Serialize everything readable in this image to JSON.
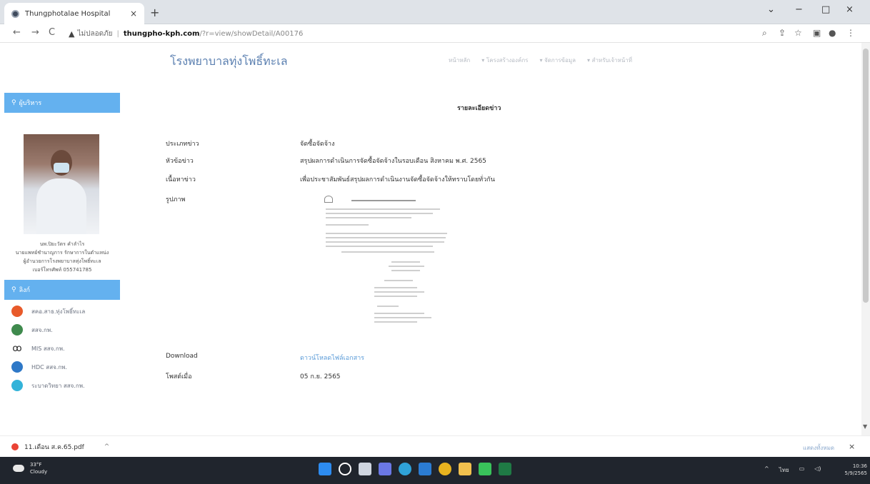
{
  "browser": {
    "tab_title": "Thungphotalae Hospital",
    "tab_close": "×",
    "new_tab": "+",
    "window_controls": {
      "chevron": "⌄",
      "minimize": "−",
      "maximize": "□",
      "close": "×"
    },
    "nav": {
      "back": "←",
      "forward": "→",
      "reload": "C"
    },
    "address": {
      "security_icon": "▲",
      "insecure_text": "ไม่ปลอดภัย",
      "separator": "|",
      "domain": "thungpho-kph.com",
      "path": "/?r=view/showDetail/A00176"
    },
    "toolbar_icons": [
      "search-icon",
      "share-icon",
      "bookmark-star-icon",
      "side-panel-icon",
      "profile-icon",
      "menu-icon"
    ]
  },
  "site": {
    "brand": "โรงพยาบาลทุ่งโพธิ์ทะเล",
    "nav_items": [
      "หน้าหลัก",
      "▾ โครงสร้างองค์กร",
      "▾ จัดการข้อมูล",
      "▾ สำหรับเจ้าหน้าที่"
    ]
  },
  "sidebar": {
    "director_header": "ผู้บริหาร",
    "person_lines": [
      "นพ.ปิยะวัตร คำลำไร",
      "นายแพทย์ชำนาญการ รักษาการในตำแหน่ง",
      "ผู้อำนวยการโรงพยาบาลทุ่งโพธิ์ทะเล",
      "เบอร์โทรศัพท์ 055741785"
    ],
    "links_header": "ลิงก์",
    "links": [
      {
        "label": "สคอ.สาธ.ทุ่งโพธิ์ทะเล",
        "icon": "emblem-icon",
        "color": "#e85a2a"
      },
      {
        "label": "สสจ.กพ.",
        "icon": "globe-green-icon",
        "color": "#3f8a4d"
      },
      {
        "label": "MIS สสจ.กพ.",
        "icon": "network-icon",
        "color": "#222222"
      },
      {
        "label": "HDC สสจ.กพ.",
        "icon": "globe-blue-icon",
        "color": "#2e78c7"
      },
      {
        "label": "ระบาดวิทยา สสจ.กพ.",
        "icon": "globe-cyan-icon",
        "color": "#33b3d9"
      }
    ]
  },
  "content": {
    "title": "รายละเอียดข่าว",
    "fields": [
      {
        "key": "ประเภทข่าว",
        "value": "จัดซื้อจัดจ้าง"
      },
      {
        "key": "หัวข้อข่าว",
        "value": "สรุปผลการดำเนินการจัดซื้อจัดจ้างในรอบเดือน สิงหาคม พ.ศ. 2565"
      },
      {
        "key": "เนื้อหาข่าว",
        "value": "เพื่อประชาสัมพันธ์สรุปผลการดำเนินงานจัดซื้อจัดจ้างให้ทราบโดยทั่วกัน"
      },
      {
        "key": "รูปภาพ",
        "value": ""
      }
    ],
    "download_key": "Download",
    "download_link": "ดาวน์โหลดไฟล์เอกสาร",
    "posted_key": "โพสต์เมื่อ",
    "posted_value": "05 ก.ย. 2565"
  },
  "download_bar": {
    "filename": "11.เดือน ส.ค.65.pdf",
    "chevron": "^",
    "show_all": "แสดงทั้งหมด",
    "close": "×"
  },
  "taskbar": {
    "weather_temp": "33°F",
    "weather_desc": "Cloudy",
    "apps": [
      {
        "icon": "windows-start-icon",
        "color": "#2d8cf0"
      },
      {
        "icon": "search-icon",
        "color": "#ffffff"
      },
      {
        "icon": "task-view-icon",
        "color": "#cfd6e0"
      },
      {
        "icon": "chat-icon",
        "color": "#6b78e5"
      },
      {
        "icon": "edge-icon",
        "color": "#2fa3d9"
      },
      {
        "icon": "mail-icon",
        "color": "#2b7cd3"
      },
      {
        "icon": "chrome-icon",
        "color": "#e8b31f"
      },
      {
        "icon": "explorer-icon",
        "color": "#f2c14e"
      },
      {
        "icon": "line-icon",
        "color": "#39c35b"
      },
      {
        "icon": "excel-icon",
        "color": "#1f7a45"
      }
    ],
    "tray": {
      "chevron": "^",
      "lang": "ไทย",
      "network": "▭",
      "volume": "◁)"
    },
    "time": "10:36",
    "date": "5/9/2565"
  }
}
